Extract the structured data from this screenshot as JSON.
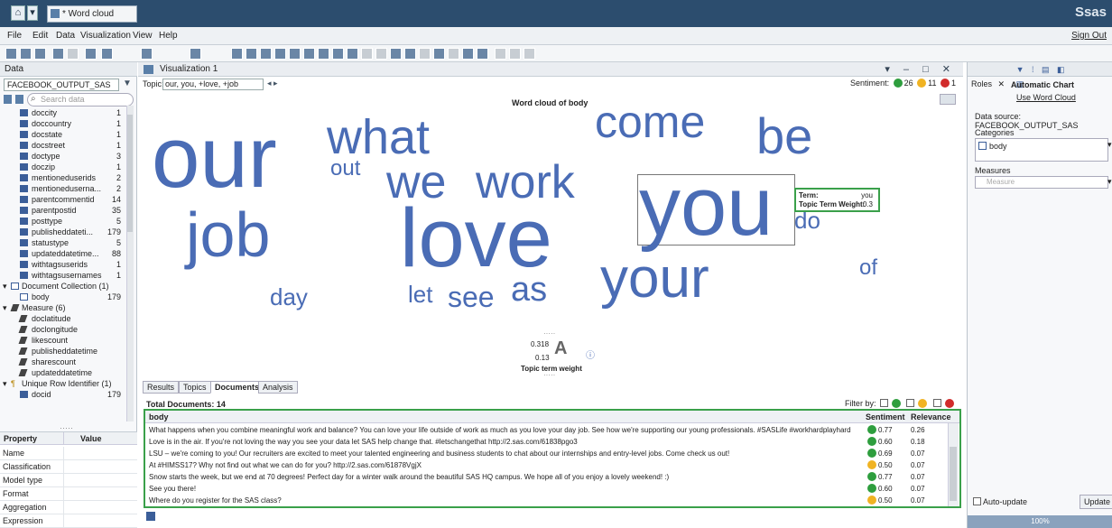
{
  "window": {
    "tab_title": "* Word cloud",
    "brand": "Ssas"
  },
  "menu": {
    "items": [
      "File",
      "Edit",
      "Data",
      "Visualization",
      "View",
      "Help"
    ],
    "sign_out": "Sign Out"
  },
  "data_panel": {
    "header": "Data",
    "data_source": "FACEBOOK_OUTPUT_SAS",
    "search_placeholder": "Search data",
    "items": [
      {
        "label": "doccity",
        "count": "1"
      },
      {
        "label": "doccountry",
        "count": "1"
      },
      {
        "label": "docstate",
        "count": "1"
      },
      {
        "label": "docstreet",
        "count": "1"
      },
      {
        "label": "doctype",
        "count": "3"
      },
      {
        "label": "doczip",
        "count": "1"
      },
      {
        "label": "mentioneduserids",
        "count": "2"
      },
      {
        "label": "mentioneduserna...",
        "count": "2"
      },
      {
        "label": "parentcommentid",
        "count": "14"
      },
      {
        "label": "parentpostid",
        "count": "35"
      },
      {
        "label": "posttype",
        "count": "5"
      },
      {
        "label": "publisheddateti...",
        "count": "179"
      },
      {
        "label": "statustype",
        "count": "5"
      },
      {
        "label": "updateddatetime...",
        "count": "88"
      },
      {
        "label": "withtagsuserids",
        "count": "1"
      },
      {
        "label": "withtagsusernames",
        "count": "1"
      }
    ],
    "doc_collection": {
      "label": "Document Collection (1)",
      "child": "body",
      "count": "179"
    },
    "measures": {
      "label": "Measure (6)",
      "items": [
        "doclatitude",
        "doclongitude",
        "likescount",
        "publisheddatetime",
        "sharescount",
        "updateddatetime"
      ]
    },
    "unique": {
      "label": "Unique Row Identifier (1)",
      "child": "docid",
      "count": "179"
    },
    "properties": {
      "col1": "Property",
      "col2": "Value",
      "rows": [
        "Name",
        "Classification",
        "Model type",
        "Format",
        "Aggregation",
        "Expression"
      ]
    }
  },
  "viz": {
    "title": "Visualization 1",
    "topic_label": "Topic:",
    "topic_value": "our, you, +love, +job",
    "sentiment_label": "Sentiment:",
    "sent_pos": "26",
    "sent_neu": "11",
    "sent_neg": "1",
    "cloud_title": "Word cloud of body",
    "words": [
      "our",
      "what",
      "out",
      "we",
      "work",
      "come",
      "be",
      "you",
      "do",
      "job",
      "love",
      "your",
      "of",
      "day",
      "let",
      "see",
      "as"
    ],
    "tooltip": {
      "term_label": "Term:",
      "term_value": "you",
      "weight_label": "Topic Term Weight:",
      "weight_value": "0.3"
    },
    "legend": {
      "max": "0.318",
      "min": "0.13",
      "label": "Topic term weight",
      "glyph": "A"
    }
  },
  "tabs": [
    "Results",
    "Topics",
    "Documents",
    "Analysis"
  ],
  "documents": {
    "total": "Total Documents: 14",
    "filter_label": "Filter by:",
    "headers": [
      "body",
      "Sentiment",
      "Relevance"
    ],
    "rows": [
      {
        "body": "What happens when you combine meaningful work and balance? You can love your life outside of work as much as you love your day job. See how we're supporting our young professionals. #SASLife #workhardplayhard",
        "sentiment": "0.77",
        "mood": "pos",
        "relevance": "0.26"
      },
      {
        "body": "Love is in the air.  If you're not loving the way you see your data let SAS help change that. #letschangethat http://2.sas.com/61838pgo3",
        "sentiment": "0.60",
        "mood": "pos",
        "relevance": "0.18"
      },
      {
        "body": "LSU – we're coming to you! Our recruiters are excited to meet your talented engineering and business students to chat about our internships and entry-level jobs. Come check us out!",
        "sentiment": "0.69",
        "mood": "pos",
        "relevance": "0.07"
      },
      {
        "body": "At #HIMSS17?  Why not find out what we can do for you? http://2.sas.com/61878VgjX",
        "sentiment": "0.50",
        "mood": "neu",
        "relevance": "0.07"
      },
      {
        "body": "Snow starts the week, but we end at 70 degrees! Perfect day for a winter walk around the beautiful SAS HQ campus. We hope all of you enjoy a lovely weekend! :)",
        "sentiment": "0.77",
        "mood": "pos",
        "relevance": "0.07"
      },
      {
        "body": "See you there!",
        "sentiment": "0.60",
        "mood": "pos",
        "relevance": "0.07"
      },
      {
        "body": "Where do you register for the SAS class?",
        "sentiment": "0.50",
        "mood": "neu",
        "relevance": "0.07"
      }
    ]
  },
  "roles_panel": {
    "tab": "Roles",
    "chart_type": "Automatic Chart",
    "use_link": "Use Word Cloud",
    "data_source": "Data source: FACEBOOK_OUTPUT_SAS",
    "categories_label": "Categories",
    "category": "body",
    "measures_label": "Measures",
    "measures_placeholder": "Measure",
    "auto_update": "Auto-update",
    "update_btn": "Update",
    "progress": "100%"
  },
  "colors": {
    "word": "#4a6cb5",
    "positive": "#2e9e3e",
    "neutral": "#f0b323",
    "negative": "#d12b2b",
    "highlight": "#3aa04a"
  }
}
